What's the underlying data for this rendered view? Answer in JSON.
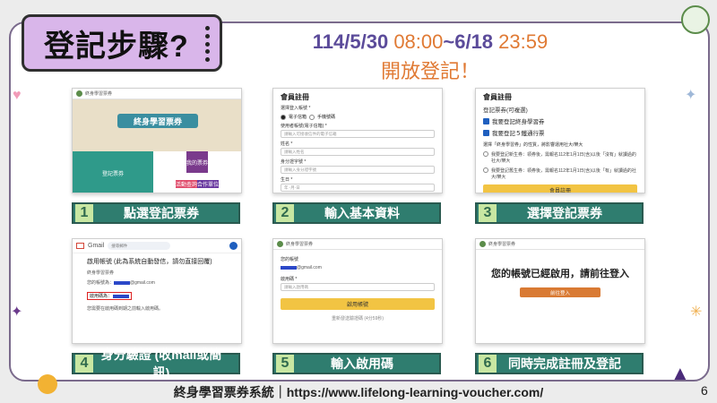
{
  "title": {
    "badge_text": "登記步驟?",
    "date_prefix": "114/5/30 ",
    "time_start": "08:00",
    "date_mid": "~6/18 ",
    "time_end": "23:59",
    "open_text": "開放登記！"
  },
  "steps": [
    {
      "num": "1",
      "label": "點選登記票券"
    },
    {
      "num": "2",
      "label": "輸入基本資料"
    },
    {
      "num": "3",
      "label": "選擇登記票券"
    },
    {
      "num": "4",
      "label": "身分驗證 (收mail或簡訊)"
    },
    {
      "num": "5",
      "label": "輸入啟用碼"
    },
    {
      "num": "6",
      "label": "同時完成註冊及登記"
    }
  ],
  "card1": {
    "site_name": "終身學習票券",
    "banner_title": "終身學習票券",
    "tiles": [
      "登記票券",
      "我的票券",
      "活動查詢",
      "合作單位"
    ]
  },
  "card2": {
    "title": "會員註冊",
    "label_type": "選擇登入帳號 *",
    "opt_email": "電子信箱",
    "opt_phone": "手機號碼",
    "label_email": "使用者帳號(電子信箱) *",
    "ph_email": "請輸入可接收信件的電子信箱",
    "label_name": "姓名 *",
    "ph_name": "請輸入姓名",
    "label_id": "身分證字號 *",
    "ph_id": "請輸入身分證字號",
    "label_birth": "生日 *",
    "ph_birth": "年 -月-日"
  },
  "card3": {
    "title": "會員註冊",
    "sub": "登記票券(可複選)",
    "check1": "我要登記終身學習券",
    "check2": "我要登記５鐵通行票",
    "question": "選擇「終身學習券」的性質，將影響運用社大/樂大",
    "radio1": "我要登記新生券：領券後，需報名112年1月1日(含)以後「沒有」就讀過的社大/樂大",
    "radio2": "我要登記舊生券：領券後，需報名112年1月1日(含)以後「有」就讀過的社大/樂大",
    "button": "會員註冊"
  },
  "card4": {
    "app_name": "Gmail",
    "search_ph": "搜尋郵件",
    "subject": "啟用帳號 (此為系統自動發信，請勿直接回覆)",
    "sender": "終身學習票券",
    "line_email_prefix": "您的帳號為：",
    "line_email_suffix": "@gmail.com",
    "line_code_prefix": "啟用碼為：",
    "line_footer": "您需要在啟用碼到期之前輸入啟用碼。"
  },
  "card5": {
    "site_name": "終身學習票券",
    "label_account": "您的帳號",
    "email_suffix": "@gmail.com",
    "label_code": "啟用碼 *",
    "ph_code": "請輸入啟用碼",
    "button": "啟用帳號",
    "resend": "重新發送驗證碼 (4分59秒)"
  },
  "card6": {
    "site_name": "終身學習票券",
    "message": "您的帳號已經啟用，請前往登入",
    "button": "前往登入"
  },
  "footer": {
    "text": "終身學習票券系統｜https://www.lifelong-learning-voucher.com/",
    "page": "6"
  },
  "colors": {
    "step_bar": "#2f7d6f",
    "badge": "#d9b6ea",
    "accent_orange": "#e07a34",
    "date_purple": "#5b4b9a"
  }
}
